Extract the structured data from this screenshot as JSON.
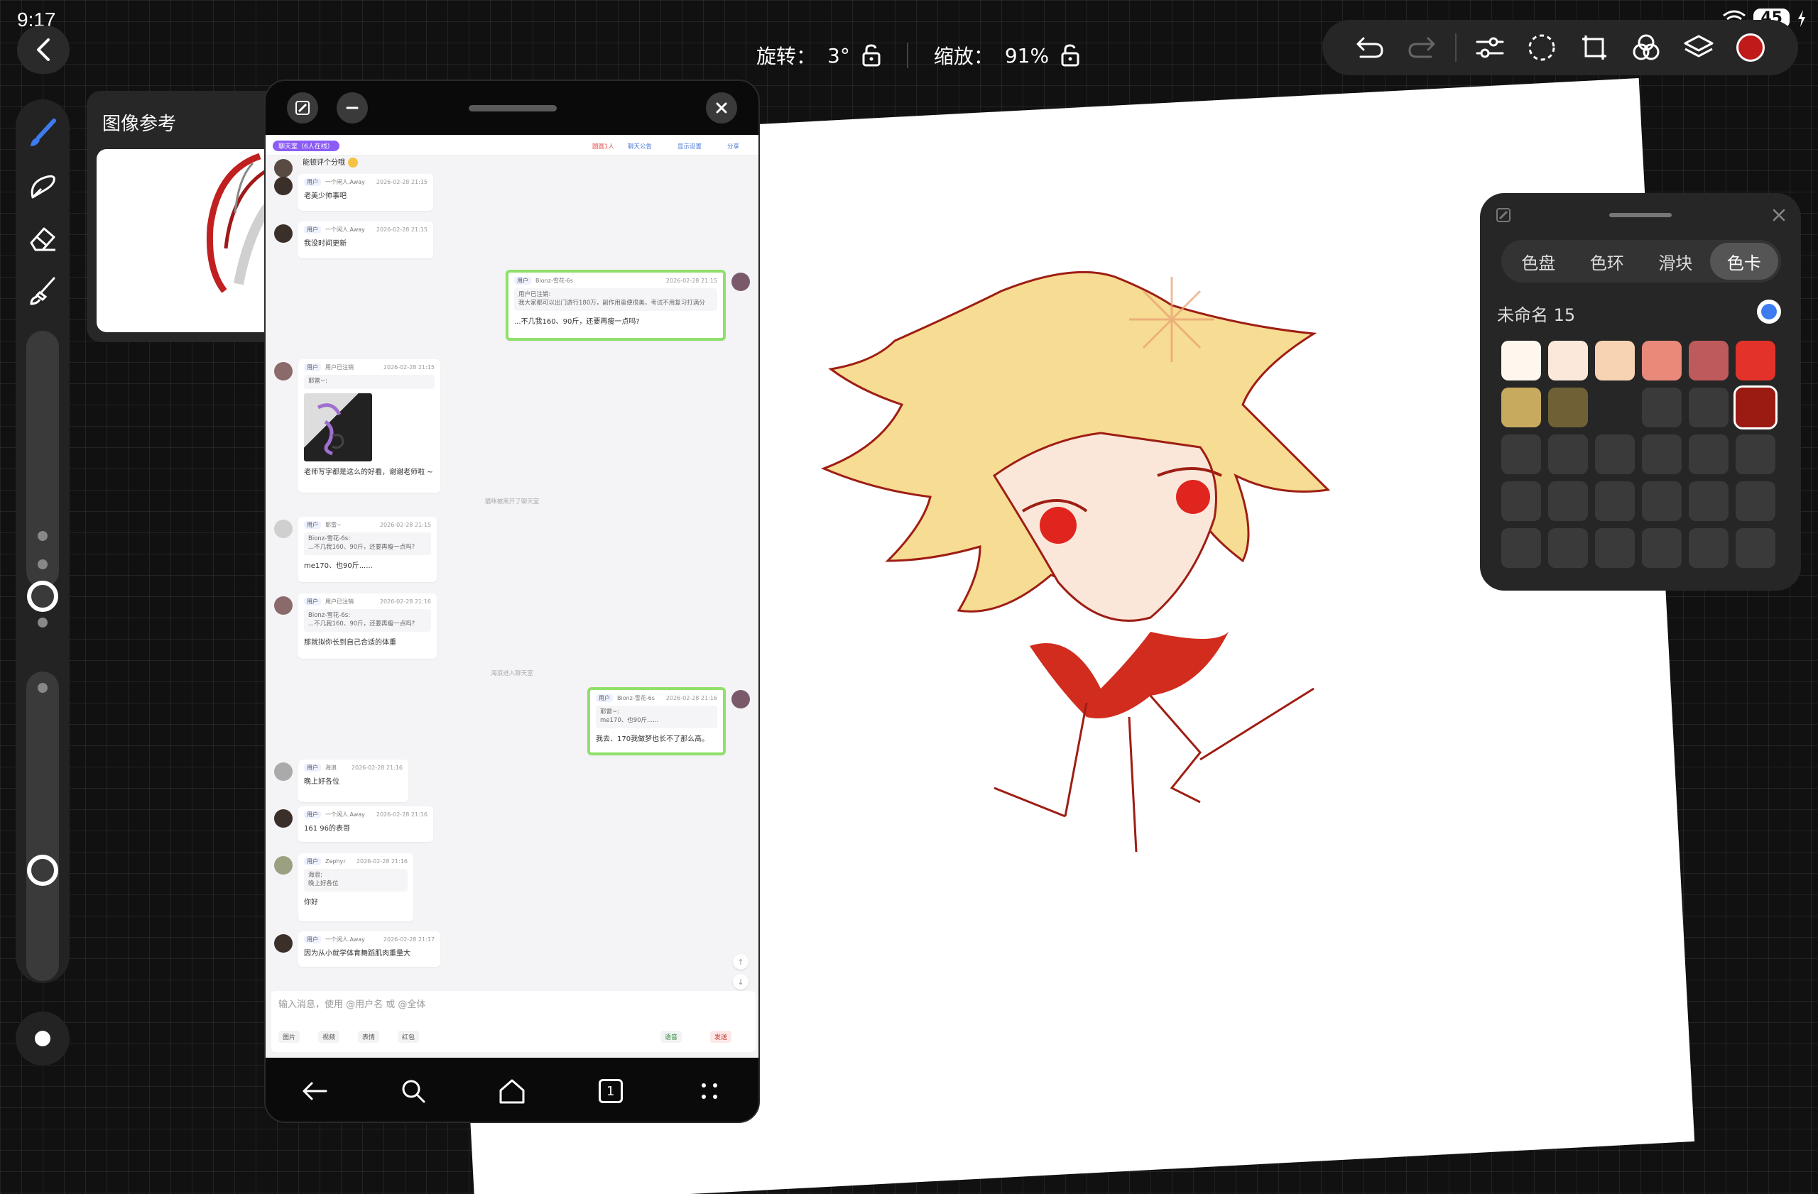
{
  "status_bar": {
    "time": "9:17",
    "battery": "45"
  },
  "transform": {
    "rotation_label": "旋转：",
    "rotation_value": "3°",
    "zoom_label": "缩放：",
    "zoom_value": "91%"
  },
  "toolbar": {
    "icons": [
      "undo-icon",
      "redo-icon",
      "adjustments-icon",
      "lasso-select-icon",
      "transform-icon",
      "blend-icon",
      "layers-icon"
    ],
    "current_color": "#c01a1a"
  },
  "reference": {
    "title": "图像参考"
  },
  "chat": {
    "room_name": "聊天室（6人在线）",
    "topbar_links": [
      "圆圆1人",
      "聊天公告",
      "显示设置",
      "分享"
    ],
    "messages": [
      {
        "text": "能顿评个分哦"
      },
      {
        "tag": "用户",
        "user": "一个闲人.Away",
        "time": "2026-02-28 21:15",
        "text": "老美少帅事吧"
      },
      {
        "tag": "用户",
        "user": "一个闲人.Away",
        "time": "2026-02-28 21:15",
        "text": "我没时间更新"
      },
      {
        "tag": "用户",
        "user": "Bionz-雪花-6s",
        "time": "2026-02-28 21:15",
        "quote": "用户已注销:\n我大家都可以出门游行180万，副作用蛮便很美，考试不用复习打满分",
        "text": "...不几我160、90斤，还要再瘦一点吗?"
      },
      {
        "tag": "用户",
        "user": "用户已注销",
        "time": "2026-02-28 21:15",
        "quote": "耶雷~:",
        "text": "老师写字都是这么的好看，谢谢老师啦 ~"
      },
      {
        "system": "猫咪被离开了聊天室"
      },
      {
        "tag": "用户",
        "user": "耶雷~",
        "time": "2026-02-28 21:15",
        "quote": "Bionz-雪花-6s:\n...不几我160、90斤，还要再瘦一点吗?",
        "text": "me170、也90斤......"
      },
      {
        "tag": "用户",
        "user": "用户已注销",
        "time": "2026-02-28 21:16",
        "quote": "Bionz-雪花-6s:\n...不几我160、90斤，还要再瘦一点吗?",
        "text": "那就拟你长到自己合适的体重"
      },
      {
        "system": "海浪进入聊天室"
      },
      {
        "tag": "用户",
        "user": "Bionz-雪花-6s",
        "time": "2026-02-28 21:16",
        "quote": "耶雷~:\nme170、也90斤......",
        "text": "我去、170我做梦也长不了那么高。"
      },
      {
        "tag": "用户",
        "user": "海浪",
        "time": "2026-02-28 21:16",
        "text": "晚上好各位"
      },
      {
        "tag": "用户",
        "user": "一个闲人.Away",
        "time": "2026-02-28 21:16",
        "text": "161 96的表哥"
      },
      {
        "tag": "用户",
        "user": "Zephyr",
        "time": "2026-02-28 21:16",
        "quote": "海浪:\n晚上好各位",
        "text": "你好"
      },
      {
        "tag": "用户",
        "user": "一个闲人.Away",
        "time": "2026-02-28 21:17",
        "text": "因为从小就学体育舞蹈肌肉重量大"
      }
    ],
    "input_placeholder": "输入消息，使用 @用户名 或 @全体",
    "input_chips": [
      "图片",
      "视频",
      "表情",
      "红包"
    ],
    "voice_label": "语音",
    "send_label": "发送",
    "scroll_up": "↑",
    "scroll_down": "↓"
  },
  "phone_nav": {
    "tabs_count": "1"
  },
  "color_panel": {
    "tabs": [
      "色盘",
      "色环",
      "滑块",
      "色卡"
    ],
    "active_tab": "色卡",
    "palette_name": "未命名 15",
    "swatches": [
      "#fdf7ee",
      "#fbe8da",
      "#f7d3b4",
      "#e9897a",
      "#be5a5b",
      "#e2322a",
      "#c8aa5e",
      "#6f6135",
      "#262626",
      "#3a3a3a",
      "#3a3a3a",
      "#9b1a12",
      "#3a3a3a",
      "#3a3a3a",
      "#3a3a3a",
      "#3a3a3a",
      "#3a3a3a",
      "#3a3a3a",
      "#3a3a3a",
      "#3a3a3a",
      "#3a3a3a",
      "#3a3a3a",
      "#3a3a3a",
      "#3a3a3a",
      "#3a3a3a",
      "#3a3a3a",
      "#3a3a3a",
      "#3a3a3a",
      "#3a3a3a",
      "#3a3a3a"
    ],
    "selected_swatch": 11
  }
}
